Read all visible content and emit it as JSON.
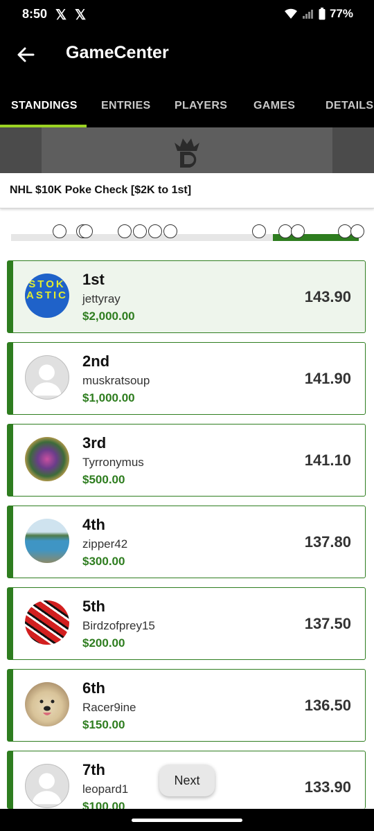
{
  "status": {
    "time": "8:50",
    "x1": "𝕏",
    "x2": "𝕏",
    "battery": "77%"
  },
  "header": {
    "title": "GameCenter"
  },
  "tabs": [
    {
      "label": "STANDINGS",
      "active": true
    },
    {
      "label": "ENTRIES"
    },
    {
      "label": "PLAYERS"
    },
    {
      "label": "GAMES"
    },
    {
      "label": "DETAILS"
    }
  ],
  "contest": {
    "title": "NHL $10K Poke Check [$2K to 1st]"
  },
  "entries": [
    {
      "rank": "1st",
      "user": "jettyray",
      "prize": "$2,000.00",
      "score": "143.90",
      "avatar": "stokastic"
    },
    {
      "rank": "2nd",
      "user": "muskratsoup",
      "prize": "$1,000.00",
      "score": "141.90",
      "avatar": "default"
    },
    {
      "rank": "3rd",
      "user": "Tyrronymus",
      "prize": "$500.00",
      "score": "141.10",
      "avatar": "mandala"
    },
    {
      "rank": "4th",
      "user": "zipper42",
      "prize": "$300.00",
      "score": "137.80",
      "avatar": "pool"
    },
    {
      "rank": "5th",
      "user": "Birdzofprey15",
      "prize": "$200.00",
      "score": "137.50",
      "avatar": "stripes"
    },
    {
      "rank": "6th",
      "user": "Racer9ine",
      "prize": "$150.00",
      "score": "136.50",
      "avatar": "dog"
    },
    {
      "rank": "7th",
      "user": "leopard1",
      "prize": "$100.00",
      "score": "133.90",
      "avatar": "default"
    }
  ],
  "avatar_text": {
    "stokastic": "STOKASTIC"
  },
  "next_button": {
    "label": "Next"
  },
  "colors": {
    "accent_green": "#2e7d1f",
    "tab_indicator": "#9bd323",
    "header_bg": "#000000"
  }
}
